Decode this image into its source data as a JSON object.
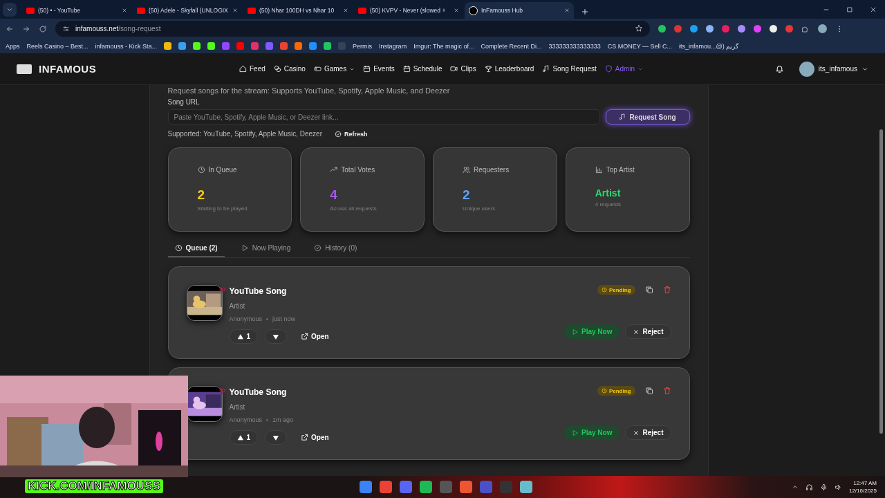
{
  "browser": {
    "tabs": [
      {
        "title": "(50) • - YouTube",
        "selected": false
      },
      {
        "title": "(50) Adele - Skyfall (UNLOGIX",
        "selected": false
      },
      {
        "title": "(50) Nhar 100DH vs Nhar 10",
        "selected": false
      },
      {
        "title": "(50) KVPV - Never (slowed +",
        "selected": false
      },
      {
        "title": "InFamouss Hub",
        "selected": true
      }
    ],
    "url": {
      "domain": "infamouss.net",
      "path": "/song-request"
    },
    "bookmarks": [
      {
        "label": "Apps"
      },
      {
        "label": "Reels Casino – Best..."
      },
      {
        "label": "infamouss - Kick Sta..."
      },
      {
        "label": "Permis"
      },
      {
        "label": "Instagram"
      },
      {
        "label": "Imgur: The magic of..."
      },
      {
        "label": "Complete Recent Di..."
      },
      {
        "label": "333333333333333"
      },
      {
        "label": "CS.MONEY — Sell C..."
      },
      {
        "label": "its_infamou...@) گريم"
      }
    ]
  },
  "navbar": {
    "logo": "INFAMOUS",
    "items": [
      {
        "label": "Feed",
        "kind": "link",
        "dropdown": false
      },
      {
        "label": "Casino",
        "kind": "link",
        "dropdown": false
      },
      {
        "label": "Games",
        "kind": "link",
        "dropdown": true
      },
      {
        "label": "Events",
        "kind": "link",
        "dropdown": false
      },
      {
        "label": "Schedule",
        "kind": "link",
        "dropdown": false
      },
      {
        "label": "Clips",
        "kind": "link",
        "dropdown": false
      },
      {
        "label": "Leaderboard",
        "kind": "link",
        "dropdown": false
      },
      {
        "label": "Song Request",
        "kind": "link",
        "dropdown": false
      },
      {
        "label": "Admin",
        "kind": "admin",
        "dropdown": true
      }
    ],
    "user": "its_infamous"
  },
  "request": {
    "intro": "Request songs for the stream: Supports YouTube, Spotify, Apple Music, and Deezer",
    "label": "Song URL",
    "placeholder": "Paste YouTube, Spotify, Apple Music, or Deezer link...",
    "button": "Request Song",
    "supported": "Supported: YouTube, Spotify, Apple Music, Deezer",
    "refresh": "Refresh"
  },
  "stats": [
    {
      "label": "In Queue",
      "value": "2",
      "caption": "Waiting to be played",
      "color": "#facc15"
    },
    {
      "label": "Total Votes",
      "value": "4",
      "caption": "Across all requests",
      "color": "#a855f7"
    },
    {
      "label": "Requesters",
      "value": "2",
      "caption": "Unique users",
      "color": "#60a5fa"
    },
    {
      "label": "Top Artist",
      "value": "Artist",
      "caption": "4 requests",
      "color": "#22e06b"
    }
  ],
  "tabs": [
    {
      "label": "Queue (2)",
      "selected": true
    },
    {
      "label": "Now Playing",
      "selected": false
    },
    {
      "label": "History (0)",
      "selected": false
    }
  ],
  "queue": [
    {
      "title": "YouTube Song",
      "artist": "Artist",
      "requester": "Anonymous",
      "time": "just now",
      "status": "Pending",
      "upvotes": "1",
      "open": "Open",
      "play": "Play Now",
      "reject": "Reject"
    },
    {
      "title": "YouTube Song",
      "artist": "Artist",
      "requester": "Anonymous",
      "time": "1m ago",
      "status": "Pending",
      "upvotes": "1",
      "open": "Open",
      "play": "Play Now",
      "reject": "Reject"
    }
  ],
  "overlay": {
    "label": "KICK.COM/INFAMOUSS"
  },
  "taskbar": {
    "time": "12:47 AM",
    "date": "12/16/2025"
  }
}
